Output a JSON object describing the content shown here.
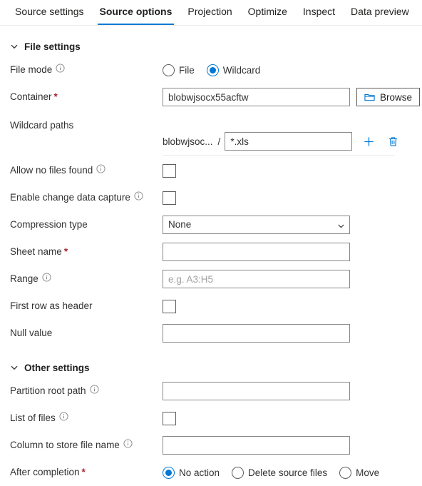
{
  "tabs": [
    {
      "label": "Source settings",
      "active": false
    },
    {
      "label": "Source options",
      "active": true
    },
    {
      "label": "Projection",
      "active": false
    },
    {
      "label": "Optimize",
      "active": false
    },
    {
      "label": "Inspect",
      "active": false
    },
    {
      "label": "Data preview",
      "active": false
    }
  ],
  "sections": {
    "file_settings": {
      "title": "File settings",
      "chevron": "chevron-down-icon"
    },
    "other_settings": {
      "title": "Other settings",
      "chevron": "chevron-down-icon"
    }
  },
  "fields": {
    "file_mode": {
      "label": "File mode",
      "info": "info-icon",
      "options": [
        {
          "label": "File",
          "selected": false
        },
        {
          "label": "Wildcard",
          "selected": true
        }
      ]
    },
    "container": {
      "label": "Container",
      "required": "*",
      "value": "blobwjsocx55acftw",
      "browse_label": "Browse",
      "browse_icon": "folder-icon"
    },
    "wildcard_paths": {
      "label": "Wildcard paths",
      "prefix": "blobwjsoc...",
      "separator": "/",
      "value": "*.xls",
      "add_icon": "plus-icon",
      "delete_icon": "trash-icon"
    },
    "allow_no_files_found": {
      "label": "Allow no files found",
      "info": "info-icon",
      "checked": false
    },
    "enable_change_data_capture": {
      "label": "Enable change data capture",
      "info": "info-icon",
      "checked": false
    },
    "compression_type": {
      "label": "Compression type",
      "value": "None",
      "options": [
        "None"
      ],
      "chevron": "chevron-down-icon"
    },
    "sheet_name": {
      "label": "Sheet name",
      "required": "*",
      "value": ""
    },
    "range": {
      "label": "Range",
      "info": "info-icon",
      "value": "",
      "placeholder": "e.g. A3:H5"
    },
    "first_row_as_header": {
      "label": "First row as header",
      "checked": false
    },
    "null_value": {
      "label": "Null value",
      "value": ""
    },
    "partition_root_path": {
      "label": "Partition root path",
      "info": "info-icon",
      "value": ""
    },
    "list_of_files": {
      "label": "List of files",
      "info": "info-icon",
      "checked": false
    },
    "column_to_store_file_name": {
      "label": "Column to store file name",
      "info": "info-icon",
      "value": ""
    },
    "after_completion": {
      "label": "After completion",
      "required": "*",
      "options": [
        {
          "label": "No action",
          "selected": true
        },
        {
          "label": "Delete source files",
          "selected": false
        },
        {
          "label": "Move",
          "selected": false
        }
      ]
    }
  },
  "colors": {
    "accent": "#0078d4",
    "required": "#a4262c",
    "border": "#8a8886",
    "text": "#323130"
  }
}
